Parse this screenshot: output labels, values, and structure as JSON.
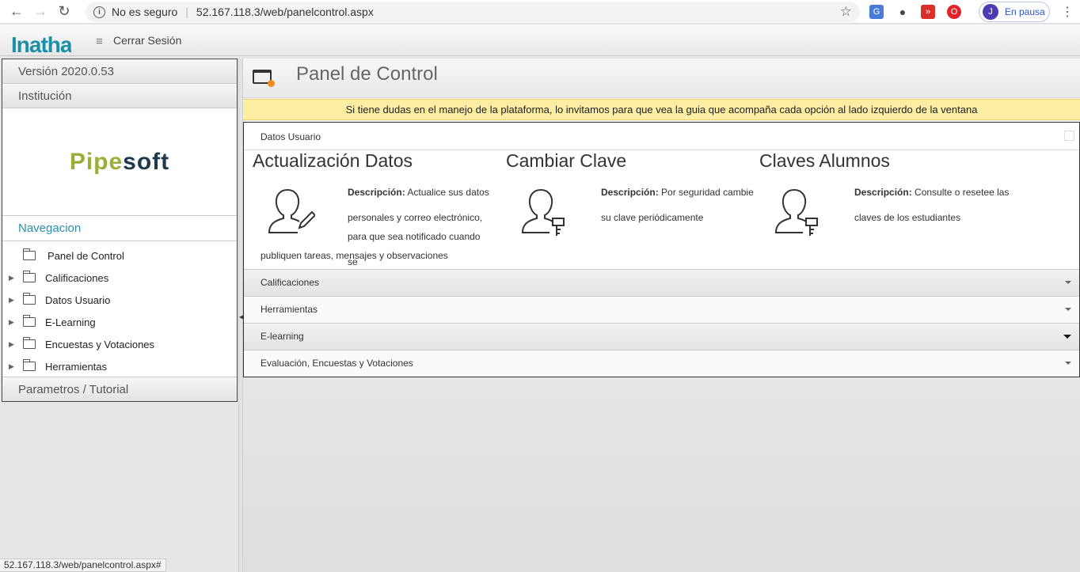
{
  "browser": {
    "back": "←",
    "forward": "→",
    "reload": "↻",
    "security_label": "No es seguro",
    "url": "52.167.118.3/web/panelcontrol.aspx",
    "star": "☆",
    "profile_initial": "J",
    "profile_status": "En pausa",
    "menu": "⋮"
  },
  "header": {
    "logo": "Inatha",
    "menu_icon": "≡",
    "logout_label": "Cerrar Sesión"
  },
  "sidebar": {
    "version": "Versión 2020.0.53",
    "institution": "Institución",
    "institution_logo_a": "Pipe",
    "institution_logo_b": "soft",
    "navigation_title": "Navegacion",
    "items": [
      {
        "label": "Panel de Control",
        "expandable": false
      },
      {
        "label": "Calificaciones",
        "expandable": true
      },
      {
        "label": "Datos Usuario",
        "expandable": true
      },
      {
        "label": "E-Learning",
        "expandable": true
      },
      {
        "label": "Encuestas y Votaciones",
        "expandable": true
      },
      {
        "label": "Herramientas",
        "expandable": true
      }
    ],
    "params": "Parametros / Tutorial"
  },
  "main": {
    "title": "Panel de Control",
    "notice": "Si tiene dudas en el manejo de la plataforma, lo invitamos para que vea la guia que acompaña cada opción al lado izquierdo de la ventana",
    "section_title": "Datos Usuario",
    "cards": [
      {
        "title": "Actualización Datos",
        "desc_label": "Descripción:",
        "desc_line1": " Actualice sus datos",
        "desc_line2": "personales y correo electrónico,",
        "desc_line3": "para que sea notificado cuando se",
        "desc_line4": "publiquen tareas, mensajes y observaciones"
      },
      {
        "title": "Cambiar Clave",
        "desc_label": "Descripción:",
        "desc_line1": " Por seguridad cambie",
        "desc_line2": "su clave periódicamente"
      },
      {
        "title": "Claves Alumnos",
        "desc_label": "Descripción:",
        "desc_line1": " Consulte o resetee las",
        "desc_line2": "claves de los estudiantes"
      }
    ],
    "sections": [
      "Calificaciones",
      "Herramientas",
      "E-learning",
      "Evaluación, Encuestas y Votaciones"
    ]
  },
  "statusbar": "52.167.118.3/web/panelcontrol.aspx#"
}
